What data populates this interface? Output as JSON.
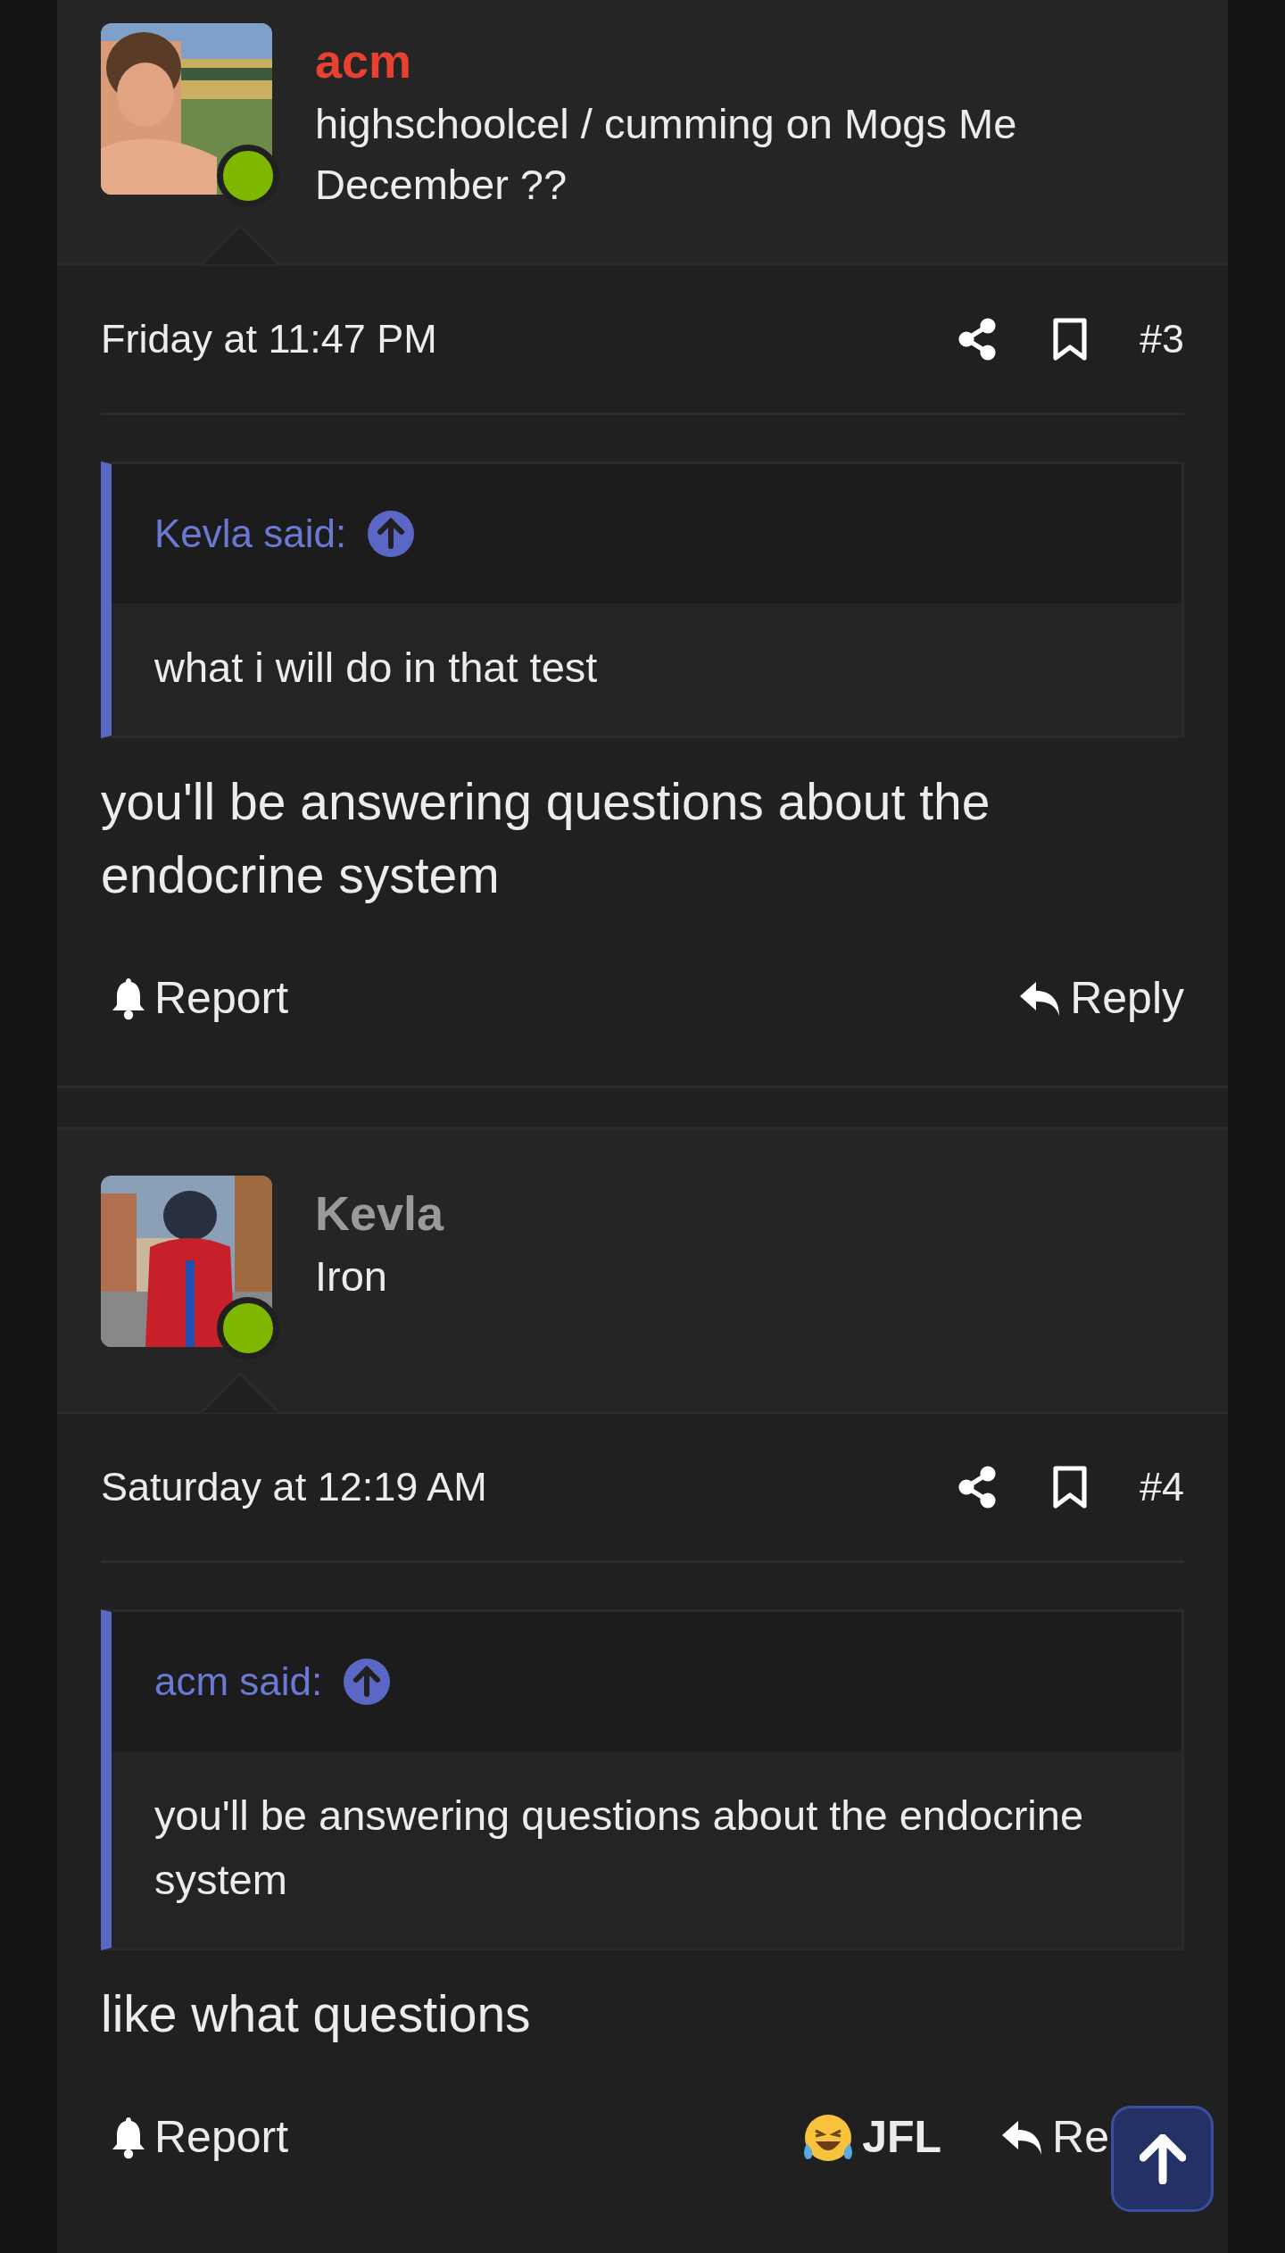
{
  "posts": [
    {
      "author": {
        "name": "acm",
        "color": "#e8412f",
        "user_title": "highschoolcel / cumming on Mogs Me December ??",
        "online": true
      },
      "date": "Friday at 11:47 PM",
      "number": "#3",
      "quote": {
        "author": "Kevla said:",
        "text": "what i will do in that test"
      },
      "body": "you'll be answering questions about the endocrine system",
      "actions": [
        {
          "kind": "report",
          "label": "Report"
        },
        {
          "kind": "reply",
          "label": "Reply"
        }
      ]
    },
    {
      "author": {
        "name": "Kevla",
        "color": "#9a9a9a",
        "user_title": "Iron",
        "online": true
      },
      "date": "Saturday at 12:19 AM",
      "number": "#4",
      "quote": {
        "author": "acm said:",
        "text": "you'll be answering questions about the endocrine system"
      },
      "body": "like what questions",
      "actions": [
        {
          "kind": "report",
          "label": "Report"
        },
        {
          "kind": "reaction",
          "label": "JFL"
        },
        {
          "kind": "reply",
          "label": "Re"
        }
      ]
    }
  ]
}
